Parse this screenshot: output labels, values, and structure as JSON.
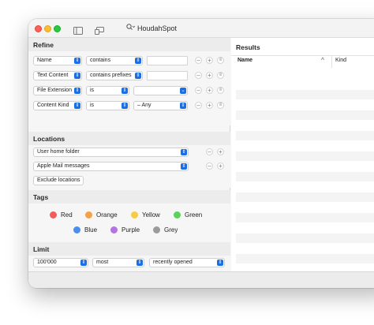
{
  "app": {
    "title": "HoudahSpot"
  },
  "refine": {
    "title": "Refine",
    "rows": [
      {
        "attribute": "Name",
        "operator": "contains",
        "value": ""
      },
      {
        "attribute": "Text Content",
        "operator": "contains prefixes",
        "value": ""
      },
      {
        "attribute": "File Extension",
        "operator": "is",
        "value": ""
      },
      {
        "attribute": "Content Kind",
        "operator": "is",
        "value": "– Any"
      }
    ]
  },
  "locations": {
    "title": "Locations",
    "items": [
      "User home folder",
      "Apple Mail messages"
    ],
    "exclude_label": "Exclude locations"
  },
  "tags": {
    "title": "Tags",
    "items": [
      {
        "name": "Red",
        "color": "#f45b5b"
      },
      {
        "name": "Orange",
        "color": "#f5a14a"
      },
      {
        "name": "Yellow",
        "color": "#f5cd45"
      },
      {
        "name": "Green",
        "color": "#5bd25b"
      },
      {
        "name": "Blue",
        "color": "#4a8ff0"
      },
      {
        "name": "Purple",
        "color": "#b373e3"
      },
      {
        "name": "Grey",
        "color": "#9b9b9b"
      }
    ]
  },
  "limit": {
    "title": "Limit",
    "count": "100'000",
    "mode": "most",
    "sort": "recently opened"
  },
  "results": {
    "title": "Results",
    "columns": [
      "Name",
      "Kind"
    ]
  }
}
